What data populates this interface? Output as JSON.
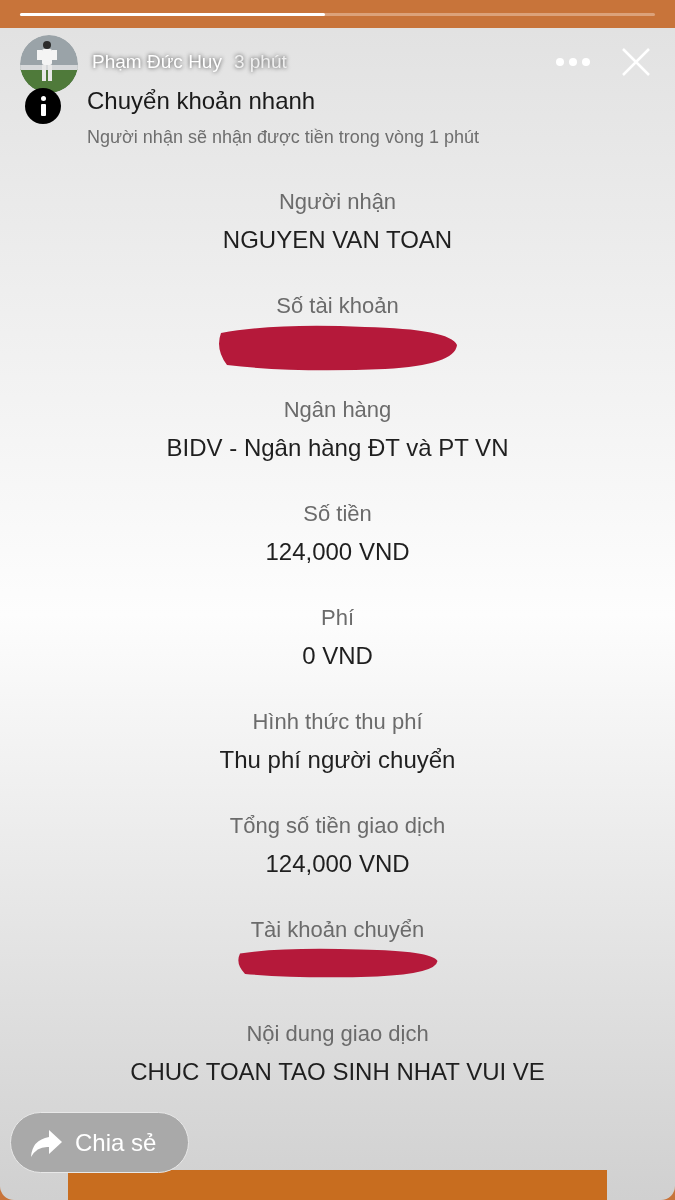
{
  "story": {
    "progress": {
      "level": 0.48
    },
    "author": "Phạm Đức Huy",
    "time": "3 phút"
  },
  "transfer": {
    "title": "Chuyển khoản nhanh",
    "subtitle": "Người nhận sẽ nhận được tiền trong vòng 1 phút",
    "fields": [
      {
        "kind": "text",
        "label": "Người nhận",
        "value": "NGUYEN VAN TOAN"
      },
      {
        "kind": "redacted",
        "label": "Số tài khoản"
      },
      {
        "kind": "text",
        "label": "Ngân hàng",
        "value": "BIDV - Ngân hàng ĐT và PT VN"
      },
      {
        "kind": "text",
        "label": "Số tiền",
        "value": "124,000 VND"
      },
      {
        "kind": "text",
        "label": "Phí",
        "value": "0 VND"
      },
      {
        "kind": "text",
        "label": "Hình thức thu phí",
        "value": "Thu phí người chuyển"
      },
      {
        "kind": "text",
        "label": "Tổng số tiền giao dịch",
        "value": "124,000 VND"
      },
      {
        "kind": "redacted",
        "label": "Tài khoản chuyển"
      },
      {
        "kind": "text",
        "label": "Nội dung giao dịch",
        "value": "CHUC TOAN TAO SINH NHAT VUI VE"
      }
    ]
  },
  "share_button": {
    "label": "Chia sẻ"
  }
}
